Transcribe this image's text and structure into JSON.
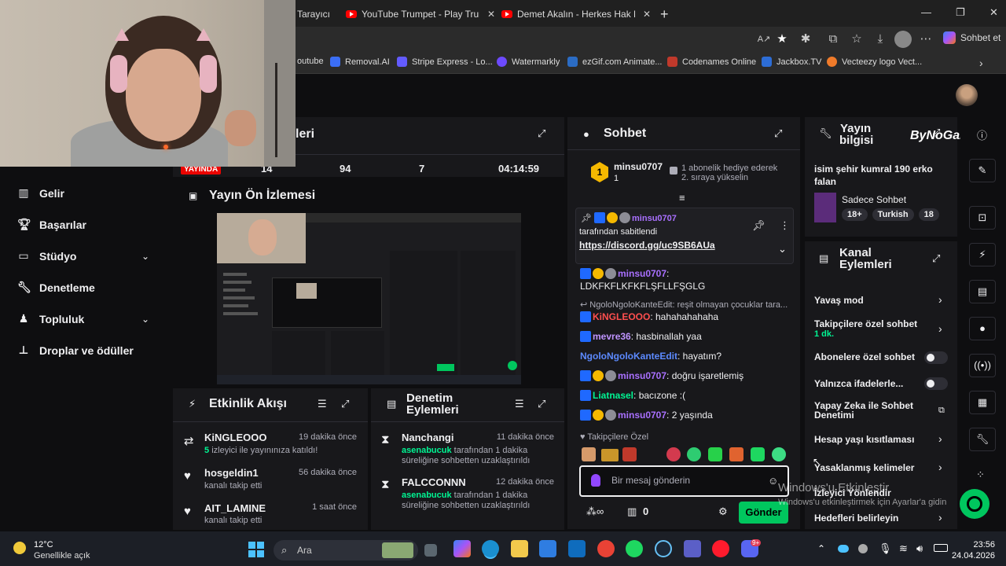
{
  "browser": {
    "tabs": [
      {
        "label": "Tarayıcı"
      },
      {
        "label": "YouTube Trumpet - Play Trumpet v"
      },
      {
        "label": "Demet Akalın - Herkes Hak Ettiği G"
      }
    ],
    "new_tab": "+",
    "copilot_label": "Sohbet et",
    "bookmarks": [
      {
        "label": "outube"
      },
      {
        "label": "Removal.AI"
      },
      {
        "label": "Stripe Express - Lo..."
      },
      {
        "label": "Watermarkly"
      },
      {
        "label": "ezGif.com Animate..."
      },
      {
        "label": "Codenames Online"
      },
      {
        "label": "Jackbox.TV"
      },
      {
        "label": "Vecteezy logo Vect..."
      }
    ]
  },
  "sidebar": {
    "items": [
      {
        "label": "Gelir"
      },
      {
        "label": "Başarılar"
      },
      {
        "label": "Stüdyo"
      },
      {
        "label": "Denetleme"
      },
      {
        "label": "Topluluk"
      },
      {
        "label": "Droplar ve ödüller"
      }
    ]
  },
  "stats": {
    "title_fragment": "leri",
    "live_label": "YAYINDA",
    "values": [
      "14",
      "94",
      "7",
      "04:14:59"
    ]
  },
  "preview": {
    "title": "Yayın Ön İzlemesi"
  },
  "activity": {
    "title": "Etkinlik Akışı",
    "items": [
      {
        "user": "KiNGLEOOO",
        "time": "19 dakika önce",
        "highlight": "5",
        "text": "izleyici ile yayınınıza katıldı!"
      },
      {
        "user": "hosgeldin1",
        "time": "56 dakika önce",
        "text": "kanalı takip etti"
      },
      {
        "user": "AIT_LAMINE",
        "time": "1 saat önce",
        "text": "kanalı takip etti"
      }
    ]
  },
  "moderation": {
    "title_line1": "Denetim",
    "title_line2": "Eylemleri",
    "items": [
      {
        "user": "Nanchangi",
        "time": "11 dakika önce",
        "mod": "asenabucuk",
        "text1": "tarafından 1 dakika",
        "text2": "süreliğine sohbetten uzaklaştırıldı"
      },
      {
        "user": "FALCCONNN",
        "time": "12 dakika önce",
        "mod": "asenabucuk",
        "text1": "tarafından 1 dakika",
        "text2": "süreliğine sohbetten uzaklaştırıldı"
      }
    ]
  },
  "chat": {
    "title": "Sohbet",
    "leader_user": "minsu0707",
    "leader_count": "1",
    "leader_note_line1": "1 abonelik hediye ederek",
    "leader_note_line2": "2. sıraya yükselin",
    "pinned_user": "minsu0707",
    "pinned_by": "tarafından sabitlendi",
    "pinned_link": "https://discord.gg/uc9SB6AUa",
    "messages": [
      {
        "user": "minsu0707",
        "text": ":",
        "color": "#a970ff"
      },
      {
        "user": "",
        "text": "LDKFKFLKFKFLŞFLLFŞGLG",
        "color": "#efeff1"
      },
      {
        "user": "",
        "text": "NgoloNgoloKanteEdit: reşit olmayan çocuklar tara...",
        "color": "#adadb8"
      },
      {
        "user": "KiNGLEOOO",
        "text": ": hahahahahaha",
        "color": "#ff4f4f"
      },
      {
        "user": "mevre36",
        "text": ": hasbinallah yaa",
        "color": "#bf94ff"
      },
      {
        "user": "NgoloNgoloKanteEdit",
        "text": ": hayatım?",
        "color": "#5c8aff"
      },
      {
        "user": "minsu0707",
        "text": ": doğru işaretlemiş",
        "color": "#a970ff"
      },
      {
        "user": "Liatnasel",
        "text": ": bacızone :(",
        "color": "#00f593"
      },
      {
        "user": "minsu0707",
        "text": ": 2 yaşında",
        "color": "#a970ff"
      }
    ],
    "followers_only": "Takipçilere Özel",
    "input_placeholder": "Bir mesaj gönderin",
    "points": "0",
    "send_label": "Gönder"
  },
  "stream_info": {
    "title_line1": "Yayın",
    "title_line2": "bilgisi",
    "brand": "ByNoGame",
    "stream_title": "isim şehir kumral 190 erko falan",
    "category": "Sadece Sohbet",
    "tags": [
      "18+",
      "Turkish",
      "18"
    ]
  },
  "channel_actions": {
    "title_line1": "Kanal",
    "title_line2": "Eylemleri",
    "items": [
      {
        "label": "Yavaş mod"
      },
      {
        "label": "Takipçilere özel sohbet",
        "sub": "1 dk."
      },
      {
        "label": "Abonelere özel sohbet"
      },
      {
        "label": "Yalnızca ifadelerle..."
      },
      {
        "label": "Yapay Zeka ile Sohbet",
        "label2": "Denetimi"
      },
      {
        "label": "Hesap yaşı kısıtlaması"
      },
      {
        "label": "Yasaklanmış kelimeler"
      },
      {
        "label": "İzleyici Yönlendir"
      },
      {
        "label": "Hedefleri belirleyin"
      }
    ]
  },
  "watermark": {
    "line1": "Windows'u Etkinleştir",
    "line2": "Windows'u etkinleştirmek için Ayarlar'a gidin"
  },
  "taskbar": {
    "weather_temp": "12°C",
    "weather_desc": "Genellikle açık",
    "search_placeholder": "Ara",
    "time": "23:56",
    "date": "24.04.2026",
    "discord_badge": "9+"
  }
}
